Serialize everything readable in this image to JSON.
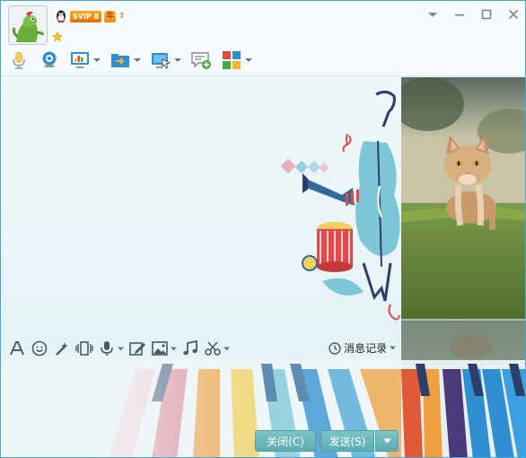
{
  "header": {
    "vip_badge": "SVIP 8",
    "year_badge": "年",
    "up_arrow": "⇧"
  },
  "window_controls": [
    "dropdown-icon",
    "minimize-icon",
    "maximize-icon",
    "close-icon"
  ],
  "toolbar": {
    "items": [
      "microphone-icon",
      "camera-icon",
      "screen-share-icon",
      "file-transfer-icon",
      "remote-desktop-icon",
      "message-add-icon",
      "apps-icon"
    ]
  },
  "input_toolbar": {
    "items": [
      "font-icon",
      "emoji-icon",
      "magic-wand-icon",
      "shake-icon",
      "voice-message-icon",
      "edit-image-icon",
      "picture-icon",
      "music-icon",
      "scissors-icon"
    ],
    "history_label": "消息记录"
  },
  "buttons": {
    "close_label": "关闭(C)",
    "send_label": "发送(S)"
  },
  "colors": {
    "frame": "#4aa6d6",
    "button": "#6cb9bd",
    "accent": "#2f8fd0"
  }
}
